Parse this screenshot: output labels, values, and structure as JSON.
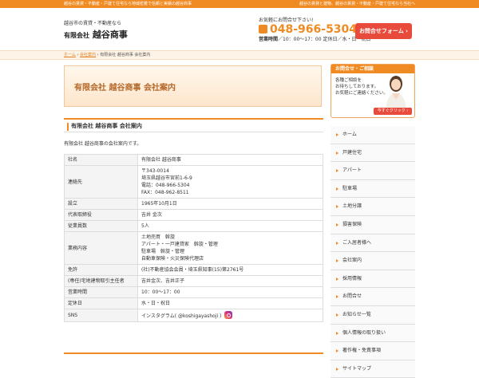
{
  "topbar": {
    "left": "越谷の賃貸・不動産・戸建て住宅なら地域密着で信頼と実績の越谷商事",
    "right": "越谷の賃貸と建物、越谷の賃貸・不動産・戸建て住宅なら当社へ"
  },
  "header": {
    "tagline": "越谷市の賃貸・不動産なら",
    "company_prefix": "有限会社",
    "company_name": "越谷商事",
    "catch": "お気軽にお問合せ下さい!",
    "phone": "048-966-5304",
    "hours_label": "営業時間",
    "hours_value": "／10：00～17：00  定休日／水・日・祝日",
    "contact_button": "お問合せフォーム ›"
  },
  "breadcrumb": {
    "home": "ホーム",
    "sep1": " › ",
    "parent": "会社案内",
    "sep2": " › ",
    "current": "有限会社 越谷商事 会社案内"
  },
  "banner_title": "有限会社 越谷商事 会社案内",
  "section_title": "有限会社 越谷商事 会社案内",
  "intro": "有限会社 越谷商事の会社案内です。",
  "table": [
    {
      "k": "社名",
      "v": [
        "有限会社 越谷商事"
      ]
    },
    {
      "k": "連絡先",
      "v": [
        "〒343-0014",
        "埼玉県越谷市宮前1-6-9",
        "電話：048-966-5304",
        "FAX：048-962-8511"
      ]
    },
    {
      "k": "設立",
      "v": [
        "1965年10月1日"
      ]
    },
    {
      "k": "代表取締役",
      "v": [
        "吉井 金次"
      ]
    },
    {
      "k": "従業員数",
      "v": [
        "5人"
      ]
    },
    {
      "k": "業務内容",
      "v": [
        "土地売買　斡旋",
        "アパート・一戸建貸家　斡旋・管理",
        "駐車場　斡旋・管理",
        "自動車保険・火災保険代理店"
      ]
    },
    {
      "k": "免許",
      "v": [
        "(社)不動産協会会員・埼玉県知事(15)第2761号"
      ]
    },
    {
      "k": "(専任)宅地建物取引主任者",
      "v": [
        "吉井金次、吉井正子"
      ]
    },
    {
      "k": "営業時間",
      "v": [
        "10：00～17：00"
      ]
    },
    {
      "k": "定休日",
      "v": [
        "水・日・祝日"
      ]
    },
    {
      "k": "SNS",
      "v": [
        "インスタグラム( @koshigayashoji )"
      ]
    }
  ],
  "sidebar": {
    "contact_head": "お問合せ・ご相談",
    "contact_lines": [
      "各種ご相談を",
      "お待ちしております。",
      "お気軽にご連絡ください。"
    ],
    "contact_button": "今すぐクリック ›",
    "nav": [
      "ホーム",
      "戸建住宅",
      "アパート",
      "駐車場",
      "土地分譲",
      "損害保険",
      "ご入居者様へ",
      "会社案内",
      "採用情報",
      "お問合せ",
      "お知らせ一覧",
      "個人情報の取り扱い",
      "著作権・免責事項",
      "サイトマップ"
    ]
  },
  "colors": {
    "accent": "#f08a22",
    "button": "#e84a3c"
  }
}
